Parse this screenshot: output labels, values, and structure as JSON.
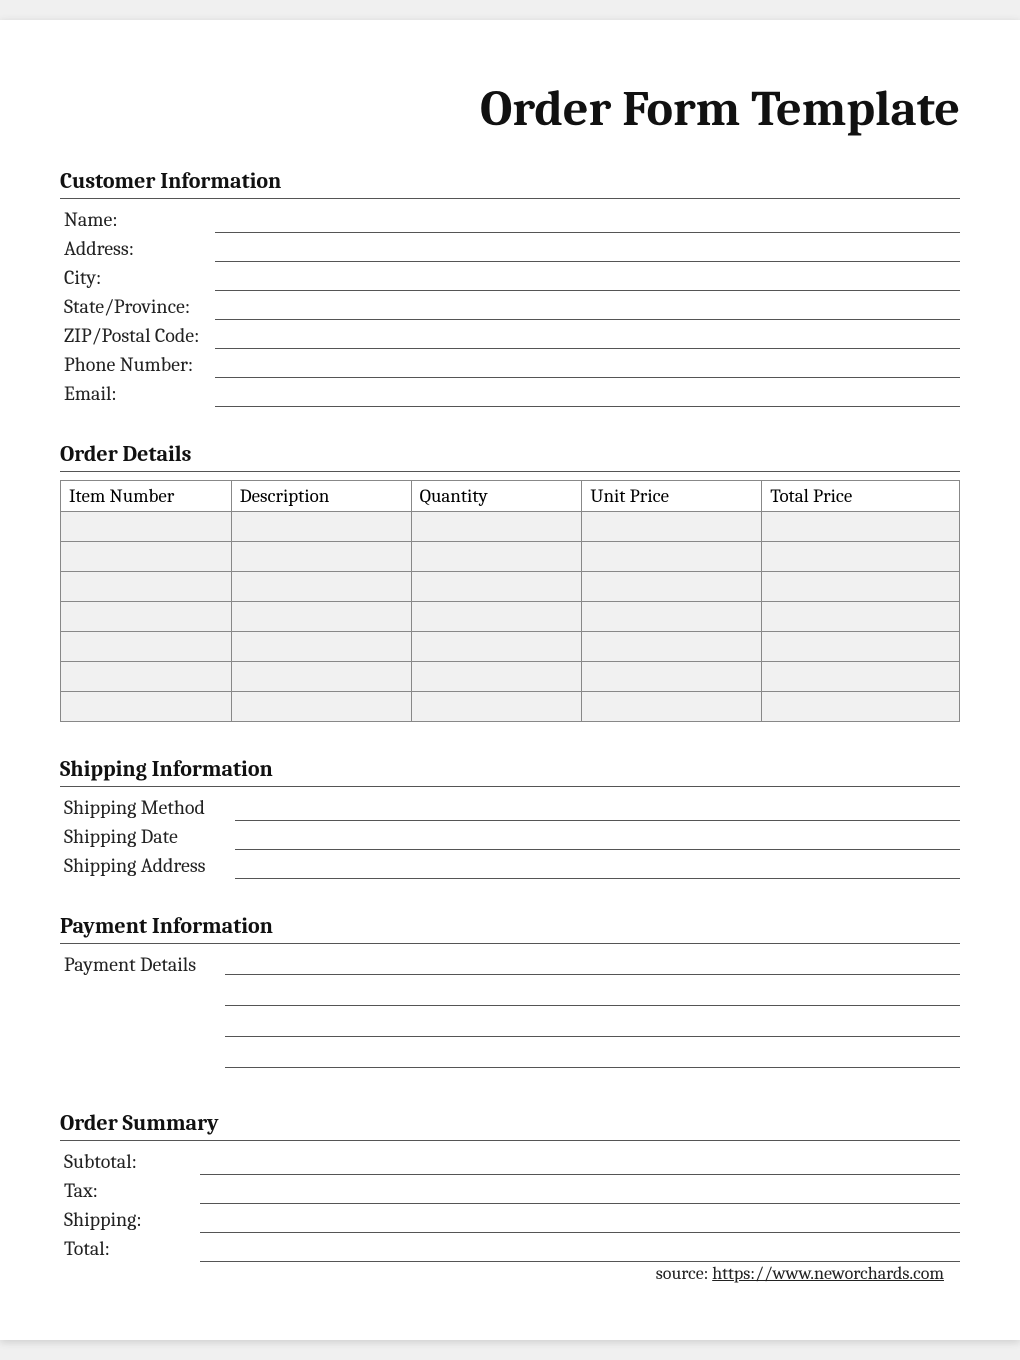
{
  "title": "Order Form Template",
  "customer": {
    "heading": "Customer Information",
    "fields": [
      {
        "label": "Name:",
        "value": ""
      },
      {
        "label": "Address:",
        "value": ""
      },
      {
        "label": "City:",
        "value": ""
      },
      {
        "label": "State/Province:",
        "value": ""
      },
      {
        "label": "ZIP/Postal Code:",
        "value": ""
      },
      {
        "label": "Phone Number:",
        "value": ""
      },
      {
        "label": "Email:",
        "value": ""
      }
    ]
  },
  "order": {
    "heading": "Order Details",
    "columns": [
      "Item Number",
      "Description",
      "Quantity",
      "Unit Price",
      "Total Price"
    ],
    "rows": [
      [
        "",
        "",
        "",
        "",
        ""
      ],
      [
        "",
        "",
        "",
        "",
        ""
      ],
      [
        "",
        "",
        "",
        "",
        ""
      ],
      [
        "",
        "",
        "",
        "",
        ""
      ],
      [
        "",
        "",
        "",
        "",
        ""
      ],
      [
        "",
        "",
        "",
        "",
        ""
      ],
      [
        "",
        "",
        "",
        "",
        ""
      ]
    ]
  },
  "shipping": {
    "heading": "Shipping Information",
    "fields": [
      {
        "label": "Shipping Method",
        "value": ""
      },
      {
        "label": "Shipping Date",
        "value": ""
      },
      {
        "label": "Shipping Address",
        "value": ""
      }
    ]
  },
  "payment": {
    "heading": "Payment Information",
    "label": "Payment Details",
    "lines": [
      "",
      "",
      "",
      ""
    ]
  },
  "summary": {
    "heading": "Order Summary",
    "fields": [
      {
        "label": "Subtotal:",
        "value": ""
      },
      {
        "label": "Tax:",
        "value": ""
      },
      {
        "label": "Shipping:",
        "value": ""
      },
      {
        "label": "Total:",
        "value": ""
      }
    ]
  },
  "source": {
    "prefix": "source: ",
    "url_text": "https://www.neworchards.com"
  }
}
